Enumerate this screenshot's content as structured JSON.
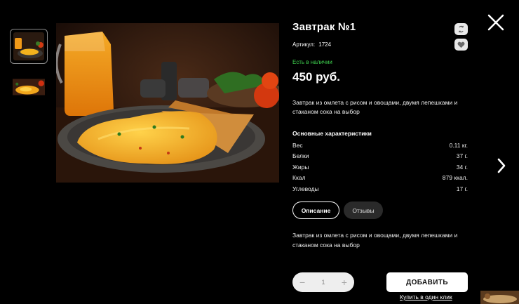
{
  "product": {
    "title": "Завтрак №1",
    "sku_label": "Артикул:",
    "sku_value": "1724",
    "stock": "Есть в наличии",
    "price": "450 руб.",
    "short_description": "Завтрак из омлета с рисом и овощами, двумя лепешками и стаканом сока на выбор",
    "specs_title": "Основные характеристики",
    "specs": [
      {
        "label": "Вес",
        "value": "0.11 кг."
      },
      {
        "label": "Белки",
        "value": "37 г."
      },
      {
        "label": "Жиры",
        "value": "34 г."
      },
      {
        "label": "Ккал",
        "value": "879 ккал."
      },
      {
        "label": "Углеводы",
        "value": "17 г."
      }
    ]
  },
  "tabs": [
    {
      "label": "Описание",
      "active": true
    },
    {
      "label": "Отзывы",
      "active": false
    }
  ],
  "description": "Завтрак из омлета с рисом и овощами, двумя лепешками и стаканом сока на выбор",
  "cart": {
    "minus": "−",
    "quantity": "1",
    "plus": "+",
    "add_label": "ДОБАВИТЬ",
    "one_click_label": "Купить в один клик"
  },
  "icons": {
    "compare": "compare-icon",
    "favorite": "heart-icon",
    "close": "close-icon",
    "next": "chevron-right-icon"
  },
  "colors": {
    "background": "#000000",
    "stock": "#3ed14f",
    "button": "#ffffff"
  }
}
